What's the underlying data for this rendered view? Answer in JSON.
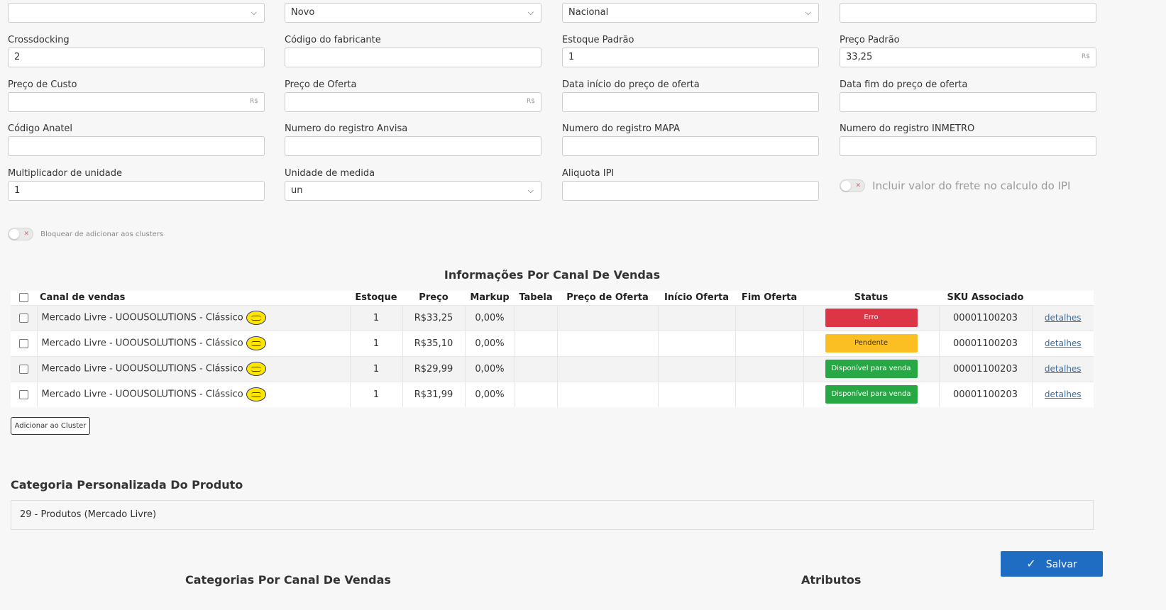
{
  "row0": {
    "sel1": "",
    "sel2": "Novo",
    "sel3": "Nacional",
    "inp4": ""
  },
  "row1": {
    "crossdocking_label": "Crossdocking",
    "crossdocking_value": "2",
    "codigo_fabricante_label": "Código do fabricante",
    "codigo_fabricante_value": "",
    "estoque_padrao_label": "Estoque Padrão",
    "estoque_padrao_value": "1",
    "preco_padrao_label": "Preço Padrão",
    "preco_padrao_value": "33,25",
    "currency": "R$"
  },
  "row2": {
    "preco_custo_label": "Preço de Custo",
    "preco_oferta_label": "Preço de Oferta",
    "data_inicio_label": "Data início do preço de oferta",
    "data_fim_label": "Data fim do preço de oferta"
  },
  "row3": {
    "anatel_label": "Código Anatel",
    "anvisa_label": "Numero do registro Anvisa",
    "mapa_label": "Numero do registro MAPA",
    "inmetro_label": "Numero do registro INMETRO"
  },
  "row4": {
    "multiplicador_label": "Multiplicador de unidade",
    "multiplicador_value": "1",
    "unidade_label": "Unidade de medida",
    "unidade_value": "un",
    "ipi_label": "Aliquota IPI",
    "frete_ipi_label": "Incluir valor do frete no calculo do IPI"
  },
  "bloquear_label": "Bloquear de adicionar aos clusters",
  "channels": {
    "title": "Informações Por Canal De Vendas",
    "headers": {
      "canal": "Canal de vendas",
      "estoque": "Estoque",
      "preco": "Preço",
      "markup": "Markup",
      "tabela": "Tabela",
      "preco_oferta": "Preço de Oferta",
      "inicio_oferta": "Início Oferta",
      "fim_oferta": "Fim Oferta",
      "status": "Status",
      "sku": "SKU Associado"
    },
    "rows": [
      {
        "canal": "Mercado Livre - UOOUSOLUTIONS - Clássico",
        "estoque": "1",
        "preco": "R$33,25",
        "markup": "0,00%",
        "status": "Erro",
        "status_color": "#dc3545",
        "status_text_color": "#ffffff",
        "sku": "00001100203",
        "link": "detalhes"
      },
      {
        "canal": "Mercado Livre - UOOUSOLUTIONS - Clássico",
        "estoque": "1",
        "preco": "R$35,10",
        "markup": "0,00%",
        "status": "Pendente",
        "status_color": "#fbbf24",
        "status_text_color": "#333333",
        "sku": "00001100203",
        "link": "detalhes"
      },
      {
        "canal": "Mercado Livre - UOOUSOLUTIONS - Clássico",
        "estoque": "1",
        "preco": "R$29,99",
        "markup": "0,00%",
        "status": "Disponível para venda",
        "status_color": "#28a745",
        "status_text_color": "#ffffff",
        "sku": "00001100203",
        "link": "detalhes"
      },
      {
        "canal": "Mercado Livre - UOOUSOLUTIONS - Clássico",
        "estoque": "1",
        "preco": "R$31,99",
        "markup": "0,00%",
        "status": "Disponível para venda",
        "status_color": "#28a745",
        "status_text_color": "#ffffff",
        "sku": "00001100203",
        "link": "detalhes"
      }
    ],
    "add_cluster_button": "Adicionar ao Cluster"
  },
  "categoria": {
    "title": "Categoria Personalizada Do Produto",
    "value": "29 - Produtos (Mercado Livre)"
  },
  "bottom": {
    "categorias_title": "Categorias Por Canal De Vendas",
    "atributos_title": "Atributos"
  },
  "save_button": "Salvar"
}
